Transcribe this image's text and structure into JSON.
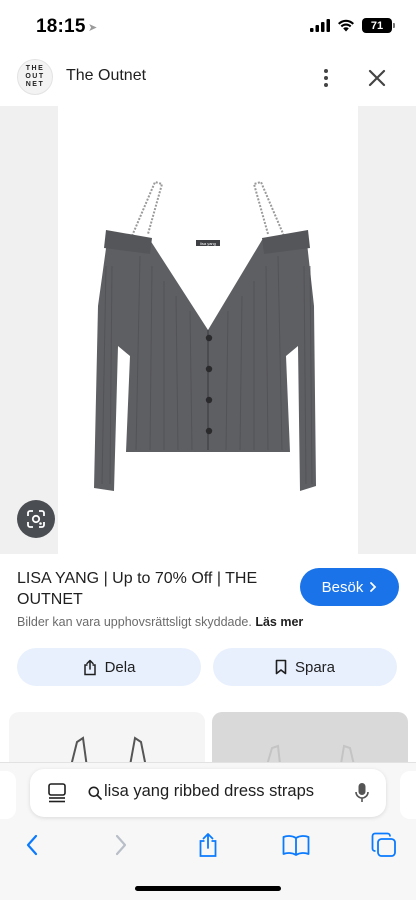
{
  "status_bar": {
    "time": "18:15",
    "battery": "71"
  },
  "header": {
    "logo_lines": [
      "THE",
      "OUT",
      "NET"
    ],
    "site_name": "The Outnet"
  },
  "product_image": {
    "label_text": "lisa yang"
  },
  "result": {
    "title": "LISA YANG | Up to 70% Off | THE OUTNET",
    "visit_label": "Besök",
    "copyright_text": "Bilder kan vara upphovsrättsligt skyddade.",
    "learn_more": "Läs mer"
  },
  "actions": {
    "share_label": "Dela",
    "save_label": "Spara"
  },
  "address_bar": {
    "query": "lisa yang ribbed dress straps"
  },
  "colors": {
    "accent": "#1a73e8",
    "pill_bg": "#e8f0fe",
    "safari_blue": "#0a7aff",
    "garment": "#5e5f63"
  },
  "icons": {
    "location": "location-arrow-icon",
    "signal": "cellular-signal-icon",
    "wifi": "wifi-icon",
    "battery": "battery-icon",
    "more": "more-vertical-icon",
    "close": "close-icon",
    "lens": "lens-search-icon",
    "share": "share-icon",
    "save": "bookmark-icon",
    "mic": "microphone-icon",
    "back": "chevron-left-icon",
    "forward": "chevron-right-icon",
    "book": "bookmarks-book-icon",
    "tabs": "tabs-icon"
  }
}
